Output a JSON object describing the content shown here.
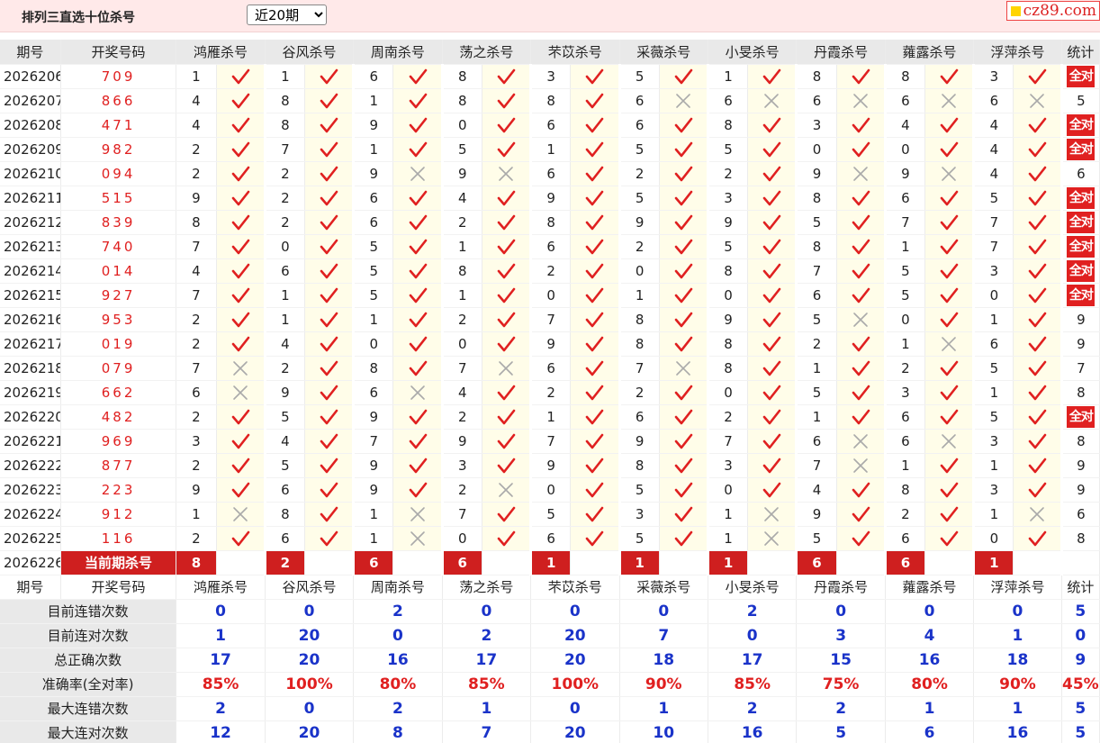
{
  "title": "排列三直选十位杀号",
  "period_select": {
    "value": "近20期"
  },
  "logo": "cz89.com",
  "col_period": "期号",
  "col_draw": "开奖号码",
  "col_total": "统计",
  "experts": [
    "鸿雁杀号",
    "谷风杀号",
    "周南杀号",
    "荡之杀号",
    "芣苡杀号",
    "采薇杀号",
    "小旻杀号",
    "丹霞杀号",
    "蕹露杀号",
    "浮萍杀号"
  ],
  "all_right": "全对",
  "rows": [
    {
      "period": "2026206",
      "draw": "709",
      "kills": [
        "1",
        "1",
        "6",
        "8",
        "3",
        "5",
        "1",
        "8",
        "8",
        "3"
      ],
      "ok": [
        1,
        1,
        1,
        1,
        1,
        1,
        1,
        1,
        1,
        1
      ],
      "total": "全对"
    },
    {
      "period": "2026207",
      "draw": "866",
      "kills": [
        "4",
        "8",
        "1",
        "8",
        "8",
        "6",
        "6",
        "6",
        "6",
        "6"
      ],
      "ok": [
        1,
        1,
        1,
        1,
        1,
        0,
        0,
        0,
        0,
        0
      ],
      "total": "5"
    },
    {
      "period": "2026208",
      "draw": "471",
      "kills": [
        "4",
        "8",
        "9",
        "0",
        "6",
        "6",
        "8",
        "3",
        "4",
        "4"
      ],
      "ok": [
        1,
        1,
        1,
        1,
        1,
        1,
        1,
        1,
        1,
        1
      ],
      "total": "全对"
    },
    {
      "period": "2026209",
      "draw": "982",
      "kills": [
        "2",
        "7",
        "1",
        "5",
        "1",
        "5",
        "5",
        "0",
        "0",
        "4"
      ],
      "ok": [
        1,
        1,
        1,
        1,
        1,
        1,
        1,
        1,
        1,
        1
      ],
      "total": "全对"
    },
    {
      "period": "2026210",
      "draw": "094",
      "kills": [
        "2",
        "2",
        "9",
        "9",
        "6",
        "2",
        "2",
        "9",
        "9",
        "4"
      ],
      "ok": [
        1,
        1,
        0,
        0,
        1,
        1,
        1,
        0,
        0,
        1
      ],
      "total": "6"
    },
    {
      "period": "2026211",
      "draw": "515",
      "kills": [
        "9",
        "2",
        "6",
        "4",
        "9",
        "5",
        "3",
        "8",
        "6",
        "5"
      ],
      "ok": [
        1,
        1,
        1,
        1,
        1,
        1,
        1,
        1,
        1,
        1
      ],
      "total": "全对"
    },
    {
      "period": "2026212",
      "draw": "839",
      "kills": [
        "8",
        "2",
        "6",
        "2",
        "8",
        "9",
        "9",
        "5",
        "7",
        "7"
      ],
      "ok": [
        1,
        1,
        1,
        1,
        1,
        1,
        1,
        1,
        1,
        1
      ],
      "total": "全对"
    },
    {
      "period": "2026213",
      "draw": "740",
      "kills": [
        "7",
        "0",
        "5",
        "1",
        "6",
        "2",
        "5",
        "8",
        "1",
        "7"
      ],
      "ok": [
        1,
        1,
        1,
        1,
        1,
        1,
        1,
        1,
        1,
        1
      ],
      "total": "全对"
    },
    {
      "period": "2026214",
      "draw": "014",
      "kills": [
        "4",
        "6",
        "5",
        "8",
        "2",
        "0",
        "8",
        "7",
        "5",
        "3"
      ],
      "ok": [
        1,
        1,
        1,
        1,
        1,
        1,
        1,
        1,
        1,
        1
      ],
      "total": "全对"
    },
    {
      "period": "2026215",
      "draw": "927",
      "kills": [
        "7",
        "1",
        "5",
        "1",
        "0",
        "1",
        "0",
        "6",
        "5",
        "0"
      ],
      "ok": [
        1,
        1,
        1,
        1,
        1,
        1,
        1,
        1,
        1,
        1
      ],
      "total": "全对"
    },
    {
      "period": "2026216",
      "draw": "953",
      "kills": [
        "2",
        "1",
        "1",
        "2",
        "7",
        "8",
        "9",
        "5",
        "0",
        "1"
      ],
      "ok": [
        1,
        1,
        1,
        1,
        1,
        1,
        1,
        0,
        1,
        1
      ],
      "total": "9"
    },
    {
      "period": "2026217",
      "draw": "019",
      "kills": [
        "2",
        "4",
        "0",
        "0",
        "9",
        "8",
        "8",
        "2",
        "1",
        "6"
      ],
      "ok": [
        1,
        1,
        1,
        1,
        1,
        1,
        1,
        1,
        0,
        1
      ],
      "total": "9"
    },
    {
      "period": "2026218",
      "draw": "079",
      "kills": [
        "7",
        "2",
        "8",
        "7",
        "6",
        "7",
        "8",
        "1",
        "2",
        "5"
      ],
      "ok": [
        0,
        1,
        1,
        0,
        1,
        0,
        1,
        1,
        1,
        1
      ],
      "total": "7"
    },
    {
      "period": "2026219",
      "draw": "662",
      "kills": [
        "6",
        "9",
        "6",
        "4",
        "2",
        "2",
        "0",
        "5",
        "3",
        "1"
      ],
      "ok": [
        0,
        1,
        0,
        1,
        1,
        1,
        1,
        1,
        1,
        1
      ],
      "total": "8"
    },
    {
      "period": "2026220",
      "draw": "482",
      "kills": [
        "2",
        "5",
        "9",
        "2",
        "1",
        "6",
        "2",
        "1",
        "6",
        "5"
      ],
      "ok": [
        1,
        1,
        1,
        1,
        1,
        1,
        1,
        1,
        1,
        1
      ],
      "total": "全对"
    },
    {
      "period": "2026221",
      "draw": "969",
      "kills": [
        "3",
        "4",
        "7",
        "9",
        "7",
        "9",
        "7",
        "6",
        "6",
        "3"
      ],
      "ok": [
        1,
        1,
        1,
        1,
        1,
        1,
        1,
        0,
        0,
        1
      ],
      "total": "8"
    },
    {
      "period": "2026222",
      "draw": "877",
      "kills": [
        "2",
        "5",
        "9",
        "3",
        "9",
        "8",
        "3",
        "7",
        "1",
        "1"
      ],
      "ok": [
        1,
        1,
        1,
        1,
        1,
        1,
        1,
        0,
        1,
        1
      ],
      "total": "9"
    },
    {
      "period": "2026223",
      "draw": "223",
      "kills": [
        "9",
        "6",
        "9",
        "2",
        "0",
        "5",
        "0",
        "4",
        "8",
        "3"
      ],
      "ok": [
        1,
        1,
        1,
        0,
        1,
        1,
        1,
        1,
        1,
        1
      ],
      "total": "9"
    },
    {
      "period": "2026224",
      "draw": "912",
      "kills": [
        "1",
        "8",
        "1",
        "7",
        "5",
        "3",
        "1",
        "9",
        "2",
        "1"
      ],
      "ok": [
        0,
        1,
        0,
        1,
        1,
        1,
        0,
        1,
        1,
        0
      ],
      "total": "6"
    },
    {
      "period": "2026225",
      "draw": "116",
      "kills": [
        "2",
        "6",
        "1",
        "0",
        "6",
        "5",
        "1",
        "5",
        "6",
        "0"
      ],
      "ok": [
        1,
        1,
        0,
        1,
        1,
        1,
        0,
        1,
        1,
        1
      ],
      "total": "8"
    }
  ],
  "current": {
    "period": "2026226",
    "label": "当前期杀号",
    "kills": [
      "8",
      "2",
      "6",
      "6",
      "1",
      "1",
      "1",
      "6",
      "6",
      "1"
    ]
  },
  "stats": [
    {
      "label": "目前连错次数",
      "values": [
        "0",
        "0",
        "2",
        "0",
        "0",
        "0",
        "2",
        "0",
        "0",
        "0"
      ],
      "total": "5",
      "red": false
    },
    {
      "label": "目前连对次数",
      "values": [
        "1",
        "20",
        "0",
        "2",
        "20",
        "7",
        "0",
        "3",
        "4",
        "1"
      ],
      "total": "0",
      "red": false
    },
    {
      "label": "总正确次数",
      "values": [
        "17",
        "20",
        "16",
        "17",
        "20",
        "18",
        "17",
        "15",
        "16",
        "18"
      ],
      "total": "9",
      "red": false
    },
    {
      "label": "准确率(全对率)",
      "values": [
        "85%",
        "100%",
        "80%",
        "85%",
        "100%",
        "90%",
        "85%",
        "75%",
        "80%",
        "90%"
      ],
      "total": "45%",
      "red": true
    },
    {
      "label": "最大连错次数",
      "values": [
        "2",
        "0",
        "2",
        "1",
        "0",
        "1",
        "2",
        "2",
        "1",
        "1"
      ],
      "total": "5",
      "red": false
    },
    {
      "label": "最大连对次数",
      "values": [
        "12",
        "20",
        "8",
        "7",
        "20",
        "10",
        "16",
        "5",
        "6",
        "16"
      ],
      "total": "5",
      "red": false
    }
  ],
  "colors": {
    "accent": "#e02020",
    "stat_blue": "#1a33c9",
    "header_bg": "#e9e9e9",
    "mark_bg": "#fffde9",
    "top_bg": "#ffe9e9"
  },
  "icons": {
    "right": "check-icon",
    "wrong": "cross-icon"
  }
}
